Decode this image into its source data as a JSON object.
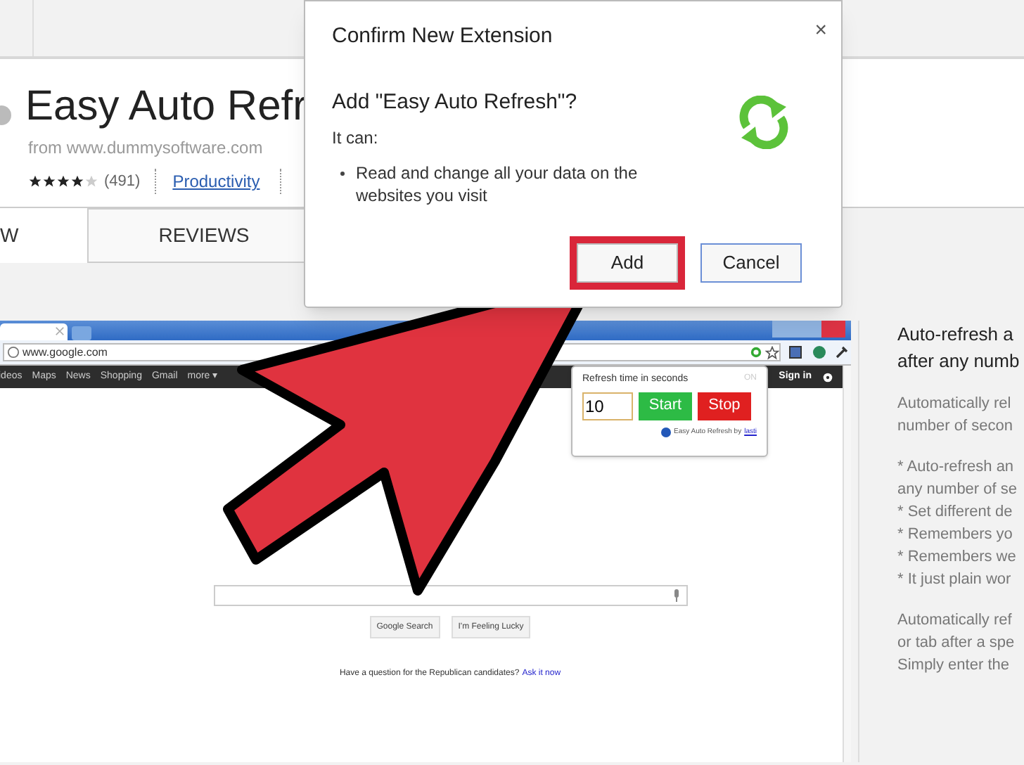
{
  "store": {
    "title": "Easy Auto Refr",
    "publisher": "from www.dummysoftware.com",
    "stars": 4,
    "rating_count": "(491)",
    "category": "Productivity",
    "tabs": [
      {
        "label": "W",
        "selected": true
      },
      {
        "label": "REVIEWS",
        "selected": false
      }
    ]
  },
  "screenshot": {
    "url": "www.google.com",
    "nav_links": [
      "ideos",
      "Maps",
      "News",
      "Shopping",
      "Gmail",
      "more ▾"
    ],
    "sign_in": "Sign in",
    "popup": {
      "label": "Refresh time in seconds",
      "status": "ON",
      "value": "10",
      "buttons": [
        {
          "label": "Start",
          "kind": "start"
        },
        {
          "label": "Stop",
          "kind": "stop"
        }
      ],
      "footer": "Easy Auto Refresh by",
      "footer_link": "lasti"
    },
    "search_buttons": [
      "Google Search",
      "I'm Feeling Lucky"
    ],
    "promo": "Have a question for the Republican candidates?",
    "promo_link": "Ask it now"
  },
  "description": {
    "title_lines": [
      "Auto-refresh a",
      "after any numb"
    ],
    "paragraphs": [
      [
        "Automatically rel",
        "number of secon"
      ],
      [
        "* Auto-refresh an",
        "any number of se",
        "* Set different de",
        "* Remembers yo",
        "* Remembers we",
        "* It just plain wor"
      ],
      [
        "Automatically ref",
        "or tab after a spe",
        "Simply enter the"
      ]
    ]
  },
  "dialog": {
    "title": "Confirm New Extension",
    "close": "×",
    "heading": "Add \"Easy Auto Refresh\"?",
    "intro": "It can:",
    "permissions": [
      "Read and change all your data on the websites you visit"
    ],
    "buttons": [
      {
        "label": "Add",
        "highlighted": true
      },
      {
        "label": "Cancel",
        "highlighted": false
      }
    ]
  }
}
